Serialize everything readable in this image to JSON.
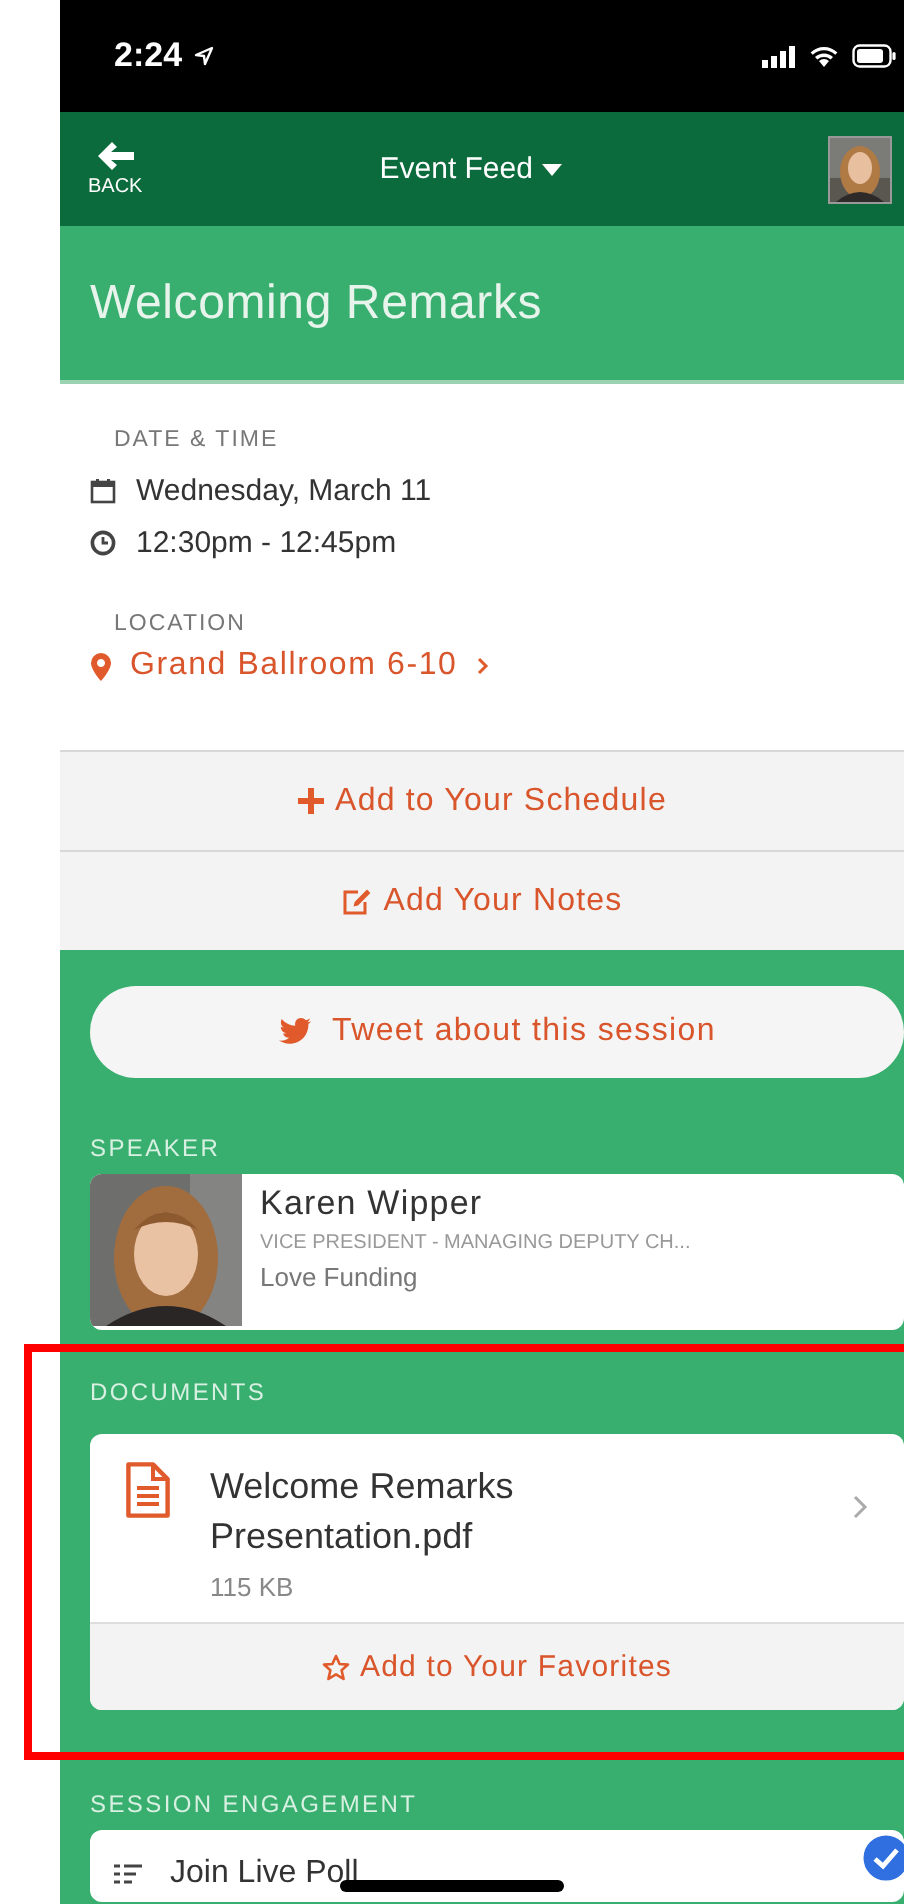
{
  "status_bar": {
    "time": "2:24"
  },
  "nav": {
    "back_label": "BACK",
    "title": "Event Feed"
  },
  "session": {
    "title": "Welcoming Remarks"
  },
  "details": {
    "date_time_label": "DATE & TIME",
    "date": "Wednesday, March 11",
    "time": "12:30pm - 12:45pm",
    "location_label": "LOCATION",
    "location": "Grand Ballroom 6-10"
  },
  "actions": [
    {
      "kind": "schedule",
      "label": "Add to Your Schedule"
    },
    {
      "kind": "notes",
      "label": "Add Your Notes"
    }
  ],
  "tweet": {
    "label": "Tweet about this session"
  },
  "speaker": {
    "section_label": "SPEAKER",
    "name": "Karen Wipper",
    "title": "VICE PRESIDENT - MANAGING DEPUTY CH...",
    "company": "Love Funding"
  },
  "documents": {
    "section_label": "DOCUMENTS",
    "items": [
      {
        "name": "Welcome Remarks Presentation.pdf",
        "size": "115 KB",
        "favorite_label": "Add to Your Favorites"
      }
    ]
  },
  "engagement": {
    "section_label": "SESSION ENGAGEMENT",
    "items": [
      {
        "label": "Join Live Poll"
      }
    ]
  }
}
